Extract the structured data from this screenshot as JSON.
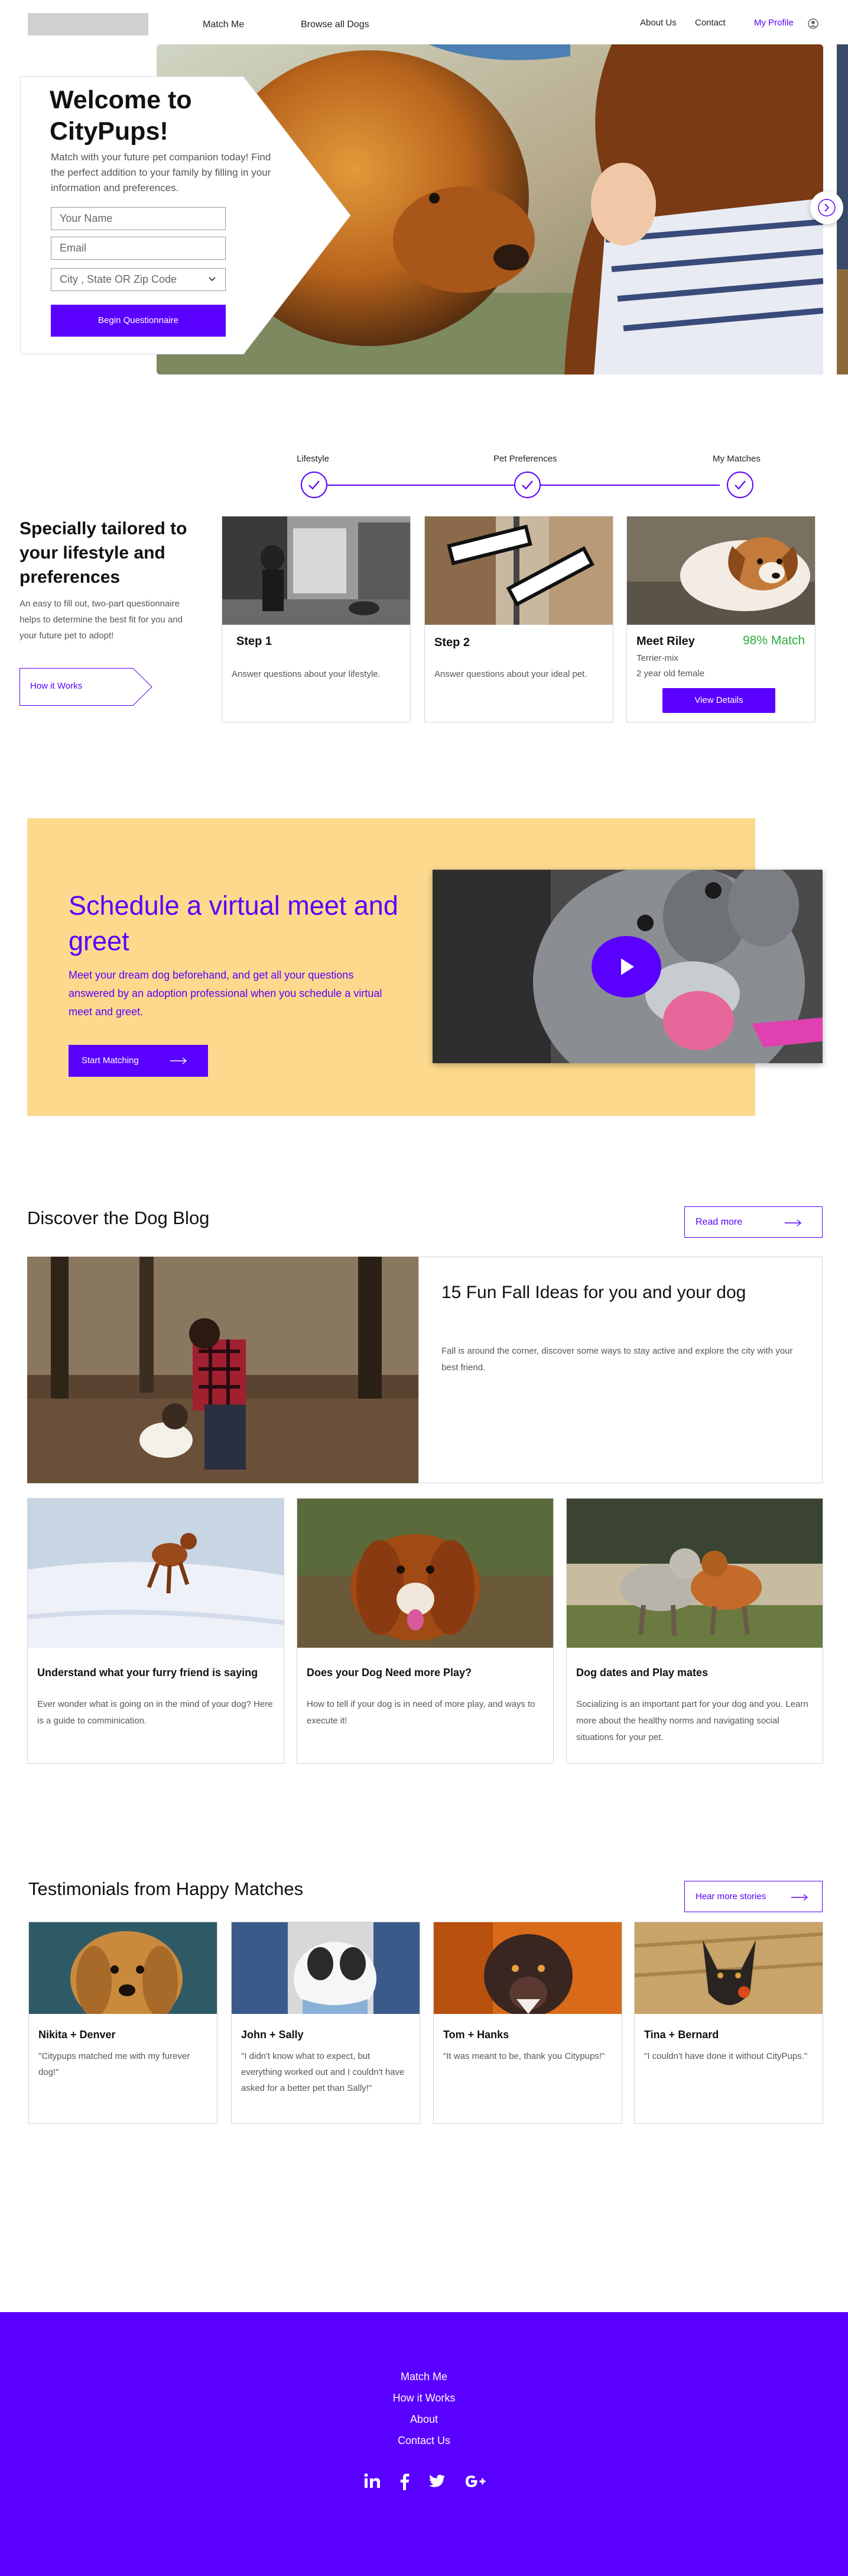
{
  "nav": {
    "links": [
      "Match Me",
      "Browse all Dogs"
    ],
    "right": [
      "About Us",
      "Contact"
    ],
    "profile": "My Profile"
  },
  "hero": {
    "title": "Welcome to CityPups!",
    "subtitle": "Match with your future pet companion today! Find the perfect addition to your family by filling in your information and preferences.",
    "name_placeholder": "Your Name",
    "email_placeholder": "Email",
    "location_placeholder": "City , State OR Zip Code",
    "cta": "Begin Questionnaire"
  },
  "steps": {
    "labels": [
      "Lifestyle",
      "Pet Preferences",
      "My Matches"
    ],
    "title": "Specially tailored to your lifestyle and preferences",
    "description": "An easy to fill out, two-part questionnaire helps to determine the best fit for you and your future pet to adopt!",
    "how_it_works": "How it Works",
    "cards": [
      {
        "title": "Step 1",
        "text": "Answer questions about your lifestyle."
      },
      {
        "title": "Step 2",
        "text": "Answer questions about your ideal pet."
      }
    ],
    "match": {
      "name": "Meet Riley",
      "percent": "98% Match",
      "breed": "Terrier-mix",
      "age": "2 year old female",
      "cta": "View Details"
    }
  },
  "schedule": {
    "title": "Schedule a virtual meet and greet",
    "description": "Meet your dream dog beforehand, and get all your questions answered by an adoption professional when you schedule a virtual meet and greet.",
    "cta": "Start Matching"
  },
  "blog": {
    "title": "Discover the Dog Blog",
    "read_more": "Read more",
    "feature": {
      "title": "15 Fun Fall Ideas for you and your dog",
      "text": "Fall is around the corner, discover some ways to stay active and explore the city with your best friend."
    },
    "posts": [
      {
        "title": "Understand what your furry friend is saying",
        "text": "Ever wonder what is going on in the mind of your dog? Here is a guide to comminication."
      },
      {
        "title": "Does your Dog Need more Play?",
        "text": "How to tell if your dog is in need of more play, and ways to execute it!"
      },
      {
        "title": "Dog dates and Play mates",
        "text": "Socializing is an important part for your dog and you. Learn more about the healthy norms and navigating social situations for your pet."
      }
    ]
  },
  "testimonials": {
    "title": "Testimonials from Happy Matches",
    "more": "Hear more stories",
    "items": [
      {
        "name": "Nikita + Denver",
        "quote": "\"Citypups matched me with my furever dog!\""
      },
      {
        "name": "John + Sally",
        "quote": "\"I didn't know what to expect, but everything worked out and I couldn't have asked for a better pet than Sally!\""
      },
      {
        "name": "Tom + Hanks",
        "quote": "\"It was meant to be, thank you Citypups!\""
      },
      {
        "name": "Tina + Bernard",
        "quote": "\"I couldn't have done it without CityPups.\""
      }
    ]
  },
  "footer": {
    "links": [
      "Match Me",
      "How it Works",
      "About",
      "Contact Us"
    ],
    "social": [
      "linkedin-icon",
      "facebook-icon",
      "twitter-icon",
      "google-plus-icon"
    ]
  },
  "colors": {
    "brand": "#5a00ff",
    "schedule_bg": "#fcd98d",
    "match_green": "#2eaa3a"
  }
}
